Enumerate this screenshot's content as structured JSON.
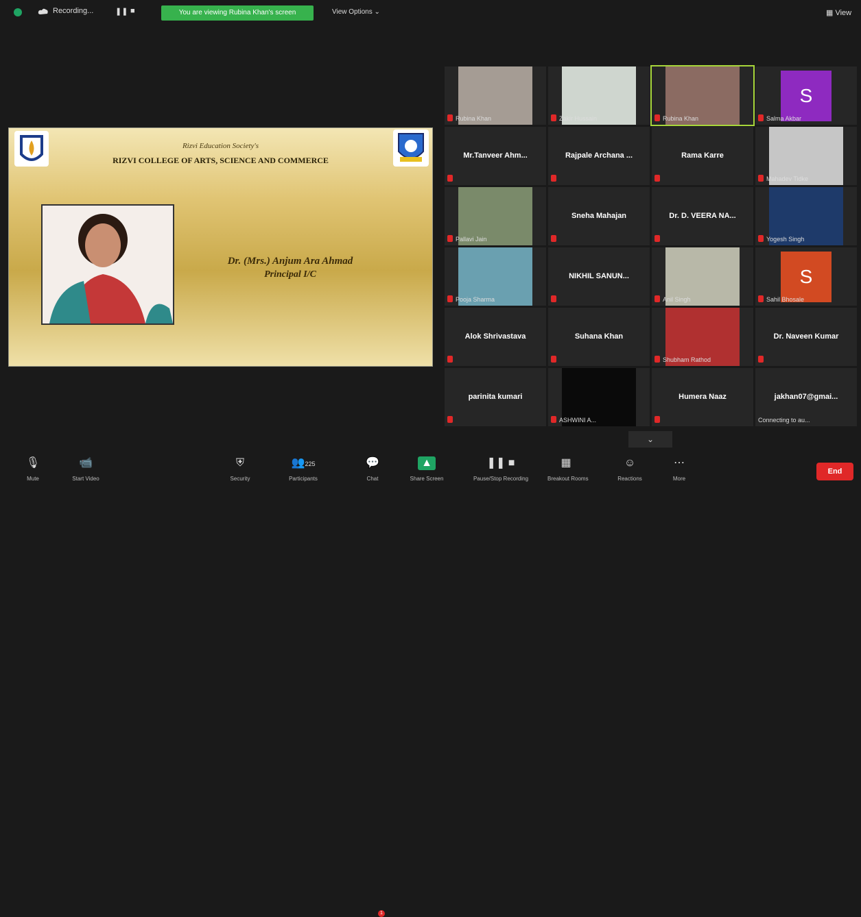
{
  "topbar": {
    "recording_label": "Recording...",
    "banner": "You are viewing Rubina Khan's screen",
    "view_options": "View Options ⌄",
    "view_button": "View"
  },
  "share": {
    "society": "Rizvi Education Society's",
    "college": "RIZVI COLLEGE OF ARTS, SCIENCE AND COMMERCE",
    "name": "Dr. (Mrs.) Anjum Ara Ahmad",
    "title": "Principal I/C"
  },
  "gallery": [
    {
      "label": "Rubina Khan",
      "type": "video",
      "bg": "#a59c94"
    },
    {
      "label": "Zakir Hussain",
      "type": "video",
      "bg": "#cfd6cf"
    },
    {
      "label": "Rubina Khan",
      "type": "video",
      "bg": "#8b6b62",
      "active": true
    },
    {
      "label": "Salma Akbar",
      "type": "avatar",
      "letter": "S",
      "bg": "#8e2ac0"
    },
    {
      "name": "Mr.Tanveer Ahm...",
      "type": "name"
    },
    {
      "name": "Rajpale Archana ...",
      "type": "name"
    },
    {
      "name": "Rama Karre",
      "type": "name"
    },
    {
      "label": "Mahadev Tidke",
      "type": "video",
      "bg": "#c6c6c6"
    },
    {
      "label": "Pallavi Jain",
      "type": "video",
      "bg": "#7a8a6a"
    },
    {
      "name": "Sneha Mahajan",
      "type": "name"
    },
    {
      "name": "Dr. D. VEERA NA...",
      "type": "name"
    },
    {
      "label": "Yogesh Singh",
      "type": "video",
      "bg": "#1e3a6a"
    },
    {
      "label": "Pooja Sharma",
      "type": "video",
      "bg": "#6aa0b0"
    },
    {
      "name": "NIKHIL SANUN...",
      "type": "name"
    },
    {
      "label": "Anil Singh",
      "type": "video",
      "bg": "#b8b8a8"
    },
    {
      "label": "Sahil Bhosale",
      "type": "avatar",
      "letter": "S",
      "bg": "#d24a22"
    },
    {
      "name": "Alok Shrivastava",
      "type": "name"
    },
    {
      "name": "Suhana Khan",
      "type": "name"
    },
    {
      "label": "Shubham Rathod",
      "type": "video",
      "bg": "#b03030"
    },
    {
      "name": "Dr. Naveen Kumar",
      "type": "name"
    },
    {
      "name": "parinita kumari",
      "type": "name"
    },
    {
      "label": "ASHWINI A...",
      "type": "video",
      "bg": "#0a0a0a"
    },
    {
      "name": "Humera Naaz",
      "type": "name"
    },
    {
      "name": "jakhan07@gmai...",
      "type": "name",
      "label_plain": "Connecting to au..."
    }
  ],
  "toolbar": {
    "mute": "Mute",
    "video": "Start Video",
    "security": "Security",
    "participants": "Participants",
    "participants_count": "225",
    "chat": "Chat",
    "chat_count": "1",
    "share": "Share Screen",
    "pause": "Pause/Stop Recording",
    "breakout": "Breakout Rooms",
    "reactions": "Reactions",
    "more": "More",
    "end": "End"
  }
}
